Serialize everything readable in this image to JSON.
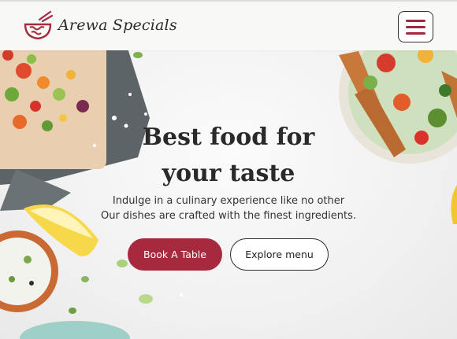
{
  "brand": {
    "name": "Arewa Specials",
    "accent_color": "#a6293e",
    "logo_icon": "bowl-with-chopsticks-icon"
  },
  "navbar": {
    "menu_icon": "hamburger-menu-icon"
  },
  "hero": {
    "title_line1": "Best food for",
    "title_line2": "your taste",
    "subtitle_line1": "Indulge in a culinary experience like no other",
    "subtitle_line2": "Our dishes are crafted with the finest ingredients.",
    "primary_button": "Book A Table",
    "secondary_button": "Explore menu"
  }
}
